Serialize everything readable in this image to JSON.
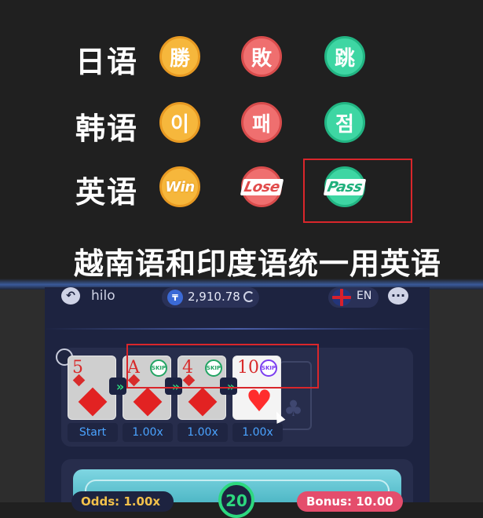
{
  "legend": {
    "rows": [
      {
        "label": "日语",
        "coins": [
          {
            "text": "勝",
            "color": "gold"
          },
          {
            "text": "敗",
            "color": "red"
          },
          {
            "text": "跳",
            "color": "green"
          }
        ]
      },
      {
        "label": "韩语",
        "coins": [
          {
            "text": "이",
            "color": "gold"
          },
          {
            "text": "패",
            "color": "red"
          },
          {
            "text": "점",
            "color": "green"
          }
        ]
      },
      {
        "label": "英语",
        "coins": [
          {
            "text": "Win",
            "color": "gold"
          },
          {
            "text": "Lose",
            "color": "red"
          },
          {
            "text": "Pass",
            "color": "green"
          }
        ]
      }
    ],
    "note": "越南语和印度语统一用英语"
  },
  "game": {
    "header": {
      "title": "hilo",
      "balance": "2,910.78",
      "balance_icon": "₸",
      "language": "EN"
    },
    "cards": [
      {
        "rank": "5",
        "suit": "diamond",
        "skip": false
      },
      {
        "rank": "A",
        "suit": "diamond",
        "skip": true,
        "skip_label": "SKIP"
      },
      {
        "rank": "4",
        "suit": "diamond",
        "skip": true,
        "skip_label": "SKIP"
      },
      {
        "rank": "10",
        "suit": "heart",
        "skip": true,
        "skip_label": "SKIP"
      }
    ],
    "multipliers": [
      "Start",
      "1.00x",
      "1.00x",
      "1.00x"
    ],
    "bottom": {
      "odds": "Odds: 1.00x",
      "timer": "20",
      "bonus": "Bonus: 10.00"
    }
  },
  "colors": {
    "gold": "#f6b73c",
    "red": "#ef6f6f",
    "green": "#3ed6a3",
    "highlight": "#d9262b",
    "game_bg": "#1d2340"
  }
}
